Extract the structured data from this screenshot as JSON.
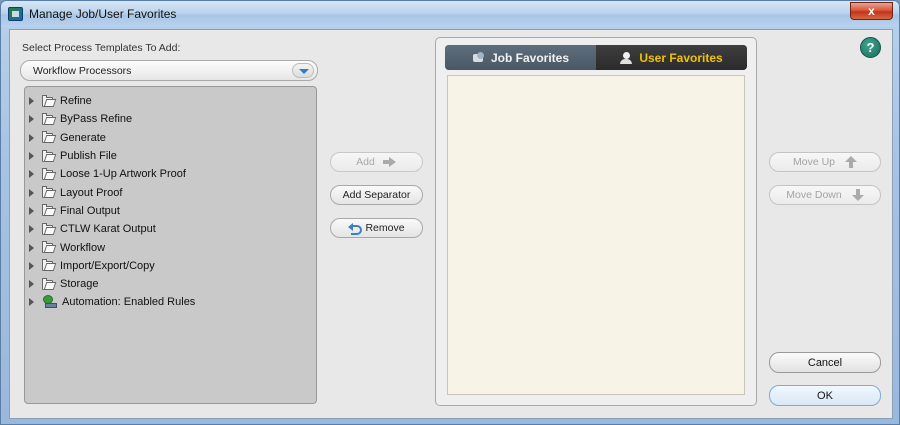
{
  "window": {
    "title": "Manage Job/User Favorites",
    "close_label": "x"
  },
  "left": {
    "label": "Select Process Templates To Add:",
    "dropdown_value": "Workflow Processors",
    "tree": [
      {
        "label": "Refine",
        "icon": "folder-icon"
      },
      {
        "label": "ByPass Refine",
        "icon": "folder-icon"
      },
      {
        "label": "Generate",
        "icon": "folder-icon"
      },
      {
        "label": "Publish File",
        "icon": "folder-icon"
      },
      {
        "label": "Loose 1-Up Artwork Proof",
        "icon": "folder-icon"
      },
      {
        "label": "Layout Proof",
        "icon": "folder-icon"
      },
      {
        "label": "Final Output",
        "icon": "folder-icon"
      },
      {
        "label": "CTLW Karat Output",
        "icon": "folder-icon"
      },
      {
        "label": "Workflow",
        "icon": "folder-icon"
      },
      {
        "label": "Import/Export/Copy",
        "icon": "folder-icon"
      },
      {
        "label": "Storage",
        "icon": "folder-icon"
      },
      {
        "label": "Automation: Enabled Rules",
        "icon": "automation-icon"
      }
    ]
  },
  "middle": {
    "add_label": "Add",
    "add_separator_label": "Add Separator",
    "remove_label": "Remove"
  },
  "favorites": {
    "tab_job": "Job Favorites",
    "tab_user": "User Favorites",
    "active_tab": "user"
  },
  "right": {
    "move_up_label": "Move Up",
    "move_down_label": "Move Down",
    "cancel_label": "Cancel",
    "ok_label": "OK",
    "help_label": "?"
  },
  "colors": {
    "active_tab_text": "#f3c200",
    "help_bg": "#1a6b5a"
  }
}
